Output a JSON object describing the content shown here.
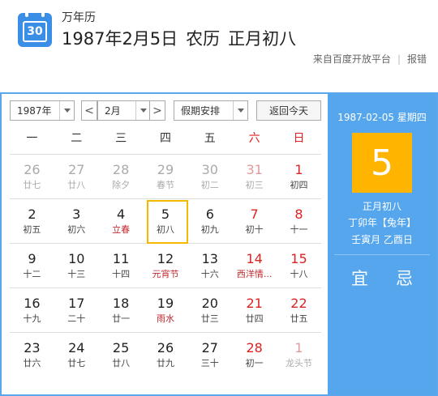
{
  "header": {
    "logo_number": "30",
    "app_name": "万年历",
    "headline_date": "1987年2月5日",
    "headline_label": "农历",
    "headline_lunar": "正月初八",
    "source_text": "来自百度开放平台",
    "report_link": "报错"
  },
  "toolbar": {
    "year": "1987年",
    "prev": "<",
    "month": "2月",
    "next": ">",
    "holiday": "假期安排",
    "today": "返回今天"
  },
  "weekdays": [
    "一",
    "二",
    "三",
    "四",
    "五",
    "六",
    "日"
  ],
  "calendar": {
    "rows": [
      [
        {
          "d": "26",
          "l": "廿七",
          "other": true
        },
        {
          "d": "27",
          "l": "廿八",
          "other": true
        },
        {
          "d": "28",
          "l": "除夕",
          "other": true
        },
        {
          "d": "29",
          "l": "春节",
          "other": true
        },
        {
          "d": "30",
          "l": "初二",
          "other": true
        },
        {
          "d": "31",
          "l": "初三",
          "other": true,
          "we": true
        },
        {
          "d": "1",
          "l": "初四",
          "we": true
        }
      ],
      [
        {
          "d": "2",
          "l": "初五"
        },
        {
          "d": "3",
          "l": "初六"
        },
        {
          "d": "4",
          "l": "立春",
          "fest": true
        },
        {
          "d": "5",
          "l": "初八",
          "sel": true
        },
        {
          "d": "6",
          "l": "初九"
        },
        {
          "d": "7",
          "l": "初十",
          "we": true
        },
        {
          "d": "8",
          "l": "十一",
          "we": true
        }
      ],
      [
        {
          "d": "9",
          "l": "十二"
        },
        {
          "d": "10",
          "l": "十三"
        },
        {
          "d": "11",
          "l": "十四"
        },
        {
          "d": "12",
          "l": "元宵节",
          "fest": true
        },
        {
          "d": "13",
          "l": "十六"
        },
        {
          "d": "14",
          "l": "西洋情...",
          "we": true,
          "fest": true
        },
        {
          "d": "15",
          "l": "十八",
          "we": true
        }
      ],
      [
        {
          "d": "16",
          "l": "十九"
        },
        {
          "d": "17",
          "l": "二十"
        },
        {
          "d": "18",
          "l": "廿一"
        },
        {
          "d": "19",
          "l": "雨水",
          "fest": true
        },
        {
          "d": "20",
          "l": "廿三"
        },
        {
          "d": "21",
          "l": "廿四",
          "we": true
        },
        {
          "d": "22",
          "l": "廿五",
          "we": true
        }
      ],
      [
        {
          "d": "23",
          "l": "廿六"
        },
        {
          "d": "24",
          "l": "廿七"
        },
        {
          "d": "25",
          "l": "廿八"
        },
        {
          "d": "26",
          "l": "廿九"
        },
        {
          "d": "27",
          "l": "三十"
        },
        {
          "d": "28",
          "l": "初一",
          "we": true
        },
        {
          "d": "1",
          "l": "龙头节",
          "other": true,
          "we": true
        }
      ]
    ]
  },
  "panel": {
    "date_line": "1987-02-05 星期四",
    "day": "5",
    "lunar": "正月初八",
    "year_gz": "丁卯年【兔年】",
    "month_day_gz": "壬寅月 乙酉日",
    "yi": "宜",
    "ji": "忌"
  },
  "colors": {
    "accent_blue": "#56a6ee",
    "highlight_yellow": "#ffb400",
    "weekend_red": "#dd2222"
  }
}
